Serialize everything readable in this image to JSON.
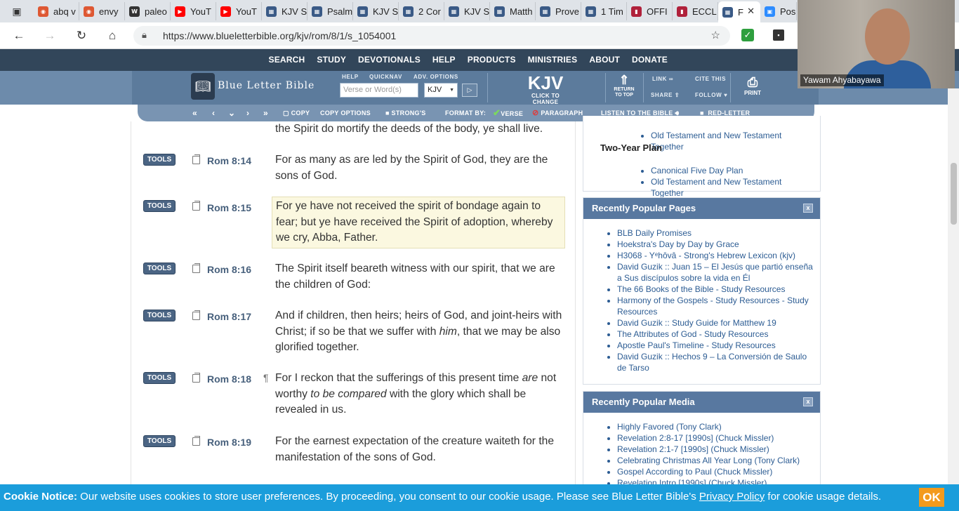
{
  "browser": {
    "tabs": [
      {
        "title": "abq v",
        "favicon": "ddg",
        "color": "#de5833"
      },
      {
        "title": "envy",
        "favicon": "ddg",
        "color": "#de5833"
      },
      {
        "title": "paleo",
        "favicon": "wiki",
        "color": "#333333"
      },
      {
        "title": "YouT",
        "favicon": "youtube",
        "color": "#ff0000"
      },
      {
        "title": "YouT",
        "favicon": "youtube",
        "color": "#ff0000"
      },
      {
        "title": "KJV S",
        "favicon": "blb",
        "color": "#3a5a86"
      },
      {
        "title": "Psalm",
        "favicon": "blb",
        "color": "#3a5a86"
      },
      {
        "title": "KJV S",
        "favicon": "blb",
        "color": "#3a5a86"
      },
      {
        "title": "2 Cor",
        "favicon": "blb",
        "color": "#3a5a86"
      },
      {
        "title": "KJV S",
        "favicon": "blb",
        "color": "#3a5a86"
      },
      {
        "title": "Matth",
        "favicon": "blb",
        "color": "#3a5a86"
      },
      {
        "title": "Prove",
        "favicon": "blb",
        "color": "#3a5a86"
      },
      {
        "title": "1 Tim",
        "favicon": "blb",
        "color": "#3a5a86"
      },
      {
        "title": "OFFI",
        "favicon": "book",
        "color": "#b0213b"
      },
      {
        "title": "ECCL",
        "favicon": "book",
        "color": "#b0213b"
      },
      {
        "title": "F",
        "favicon": "blb",
        "color": "#3a5a86",
        "active": true
      },
      {
        "title": "Pos",
        "favicon": "zoom",
        "color": "#2d8cff"
      }
    ],
    "url": "https://www.blueletterbible.org/kjv/rom/8/1/s_1054001"
  },
  "site_nav": [
    "SEARCH",
    "STUDY",
    "DEVOTIONALS",
    "HELP",
    "PRODUCTS",
    "MINISTRIES",
    "ABOUT",
    "DONATE"
  ],
  "header": {
    "logo_text": "Blue Letter Bible",
    "help_label": "HELP",
    "quicknav_label": "QUICKNAV",
    "adv_label": "ADV. OPTIONS",
    "search_placeholder": "Verse or Word(s)",
    "version_value": "KJV",
    "big_version": "KJV",
    "click_to_change": "CLICK TO CHANGE",
    "return_top": "RETURN TO TOP",
    "link_label": "LINK",
    "share_label": "SHARE",
    "cite_label": "CITE THIS",
    "follow_label": "FOLLOW",
    "print_label": "PRINT"
  },
  "toolbar2": {
    "copy": "COPY",
    "copy_options": "COPY OPTIONS",
    "strongs": "STRONG'S",
    "format_by": "FORMAT BY:",
    "verse": "VERSE",
    "paragraph": "PARAGRAPH",
    "listen": "LISTEN TO THE BIBLE",
    "red_letter": "RED-LETTER"
  },
  "partial_verse": "the Spirit do mortify the deeds of the body, ye shall live.",
  "verses": [
    {
      "tools": "TOOLS",
      "ref": "Rom 8:14",
      "text": "For as many as are led by the Spirit of God, they are the sons of God."
    },
    {
      "tools": "TOOLS",
      "ref": "Rom 8:15",
      "text": "For ye have not received the spirit of bondage again to fear; but ye have received the Spirit of adoption, whereby we cry, Abba, Father."
    },
    {
      "tools": "TOOLS",
      "ref": "Rom 8:16",
      "text": "The Spirit itself beareth witness with our spirit, that we are the children of God:"
    },
    {
      "tools": "TOOLS",
      "ref": "Rom 8:17",
      "text_a": "And if children, then heirs; heirs of God, and joint-heirs with Christ; if so be that we suffer with ",
      "italic": "him",
      "text_b": ", that we may be also glorified together."
    },
    {
      "tools": "TOOLS",
      "ref": "Rom 8:18",
      "pilcrow": "¶",
      "text_a": "For I reckon that the sufferings of this present time ",
      "italic_a": "are",
      "text_b": " not worthy ",
      "italic_b": "to be compared",
      "text_c": " with the glory which shall be revealed in us."
    },
    {
      "tools": "TOOLS",
      "ref": "Rom 8:19",
      "text": "For the earnest expectation of the creature waiteth for the manifestation of the sons of God."
    }
  ],
  "sidebar": {
    "plans_top": [
      "Old Testament and New Testament Together"
    ],
    "two_year_title": "Two-Year Plan",
    "two_year_items": [
      "Canonical Five Day Plan",
      "Old Testament and New Testament Together"
    ],
    "popular_pages_title": "Recently Popular Pages",
    "popular_pages": [
      "BLB Daily Promises",
      "Hoekstra's Day by Day by Grace",
      "H3068 - Yᵉhôvâ - Strong's Hebrew Lexicon (kjv)",
      "David Guzik :: Juan 15 – El Jesús que partió enseña a Sus discípulos sobre la vida en Él",
      "The 66 Books of the Bible - Study Resources",
      "Harmony of the Gospels - Study Resources - Study Resources",
      "David Guzik :: Study Guide for Matthew 19",
      "The Attributes of God - Study Resources",
      "Apostle Paul's Timeline - Study Resources",
      "David Guzik :: Hechos 9 – La Conversión de Saulo de Tarso"
    ],
    "popular_media_title": "Recently Popular Media",
    "popular_media": [
      "Highly Favored (Tony Clark)",
      "Revelation 2:8-17 [1990s] (Chuck Missler)",
      "Revelation 2:1-7 [1990s] (Chuck Missler)",
      "Celebrating Christmas All Year Long (Tony Clark)",
      "Gospel According to Paul (Chuck Missler)",
      "Revelation Intro [1990s] (Chuck Missler)"
    ],
    "close_glyph": "x"
  },
  "webcam": {
    "name": "Yawam Ahyabayawa"
  },
  "cookie": {
    "label": "Cookie Notice:",
    "text_a": " Our website uses cookies to store user preferences. By proceeding, you consent to our cookie usage. Please see Blue Letter Bible's ",
    "link": "Privacy Policy",
    "text_b": " for cookie usage details.",
    "ok": "OK"
  },
  "colors": {
    "nav_bg": "#32465a",
    "header_bg": "#5c7b9c",
    "accent": "#1b9ddb",
    "ok_button": "#f39a1c"
  }
}
